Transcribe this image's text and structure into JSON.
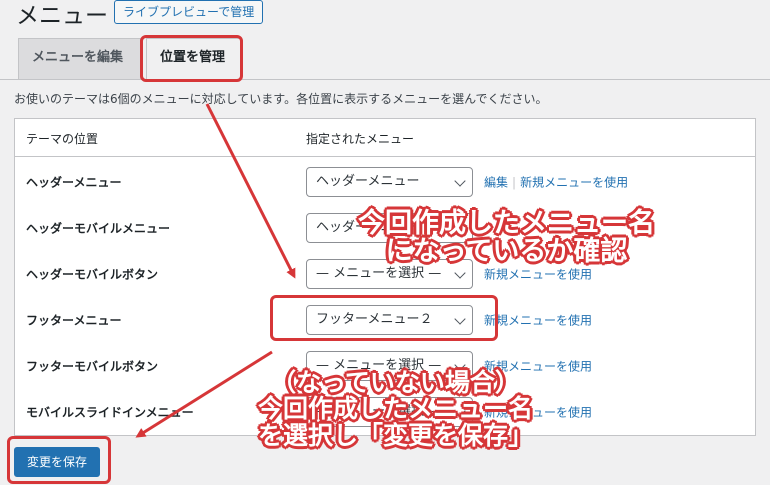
{
  "header": {
    "title": "メニュー",
    "live_preview_button": "ライブプレビューで管理"
  },
  "tabs": [
    {
      "label": "メニューを編集",
      "active": false
    },
    {
      "label": "位置を管理",
      "active": true
    }
  ],
  "description": "お使いのテーマは6個のメニューに対応しています。各位置に表示するメニューを選んでください。",
  "table": {
    "headers": {
      "location": "テーマの位置",
      "menu": "指定されたメニュー"
    },
    "rows": [
      {
        "label": "ヘッダーメニュー",
        "selected": "ヘッダーメニュー",
        "edit_link": "編集",
        "new_link": "新規メニューを使用"
      },
      {
        "label": "ヘッダーモバイルメニュー",
        "selected": "ヘッダーメニュー",
        "edit_link": "",
        "new_link": ""
      },
      {
        "label": "ヘッダーモバイルボタン",
        "selected": "— メニューを選択 —",
        "edit_link": "",
        "new_link": "新規メニューを使用"
      },
      {
        "label": "フッターメニュー",
        "selected": "フッターメニュー２",
        "edit_link": "",
        "new_link": "新規メニューを使用"
      },
      {
        "label": "フッターモバイルボタン",
        "selected": "— メニューを選択 —",
        "edit_link": "",
        "new_link": "新規メニューを使用"
      },
      {
        "label": "モバイルスライドインメニュー",
        "selected": "— メニューを選択 —",
        "edit_link": "",
        "new_link": "新規メニューを使用"
      }
    ]
  },
  "save_button": "変更を保存",
  "annotations": {
    "top": [
      "今回作成したメニュー名",
      "になっているか確認"
    ],
    "bottom": [
      "（なっていない場合）",
      "今回作成したメニュー名",
      "を選択し「変更を保存」"
    ]
  },
  "colors": {
    "accent": "#2271b1",
    "annotation_red": "#d63638"
  }
}
